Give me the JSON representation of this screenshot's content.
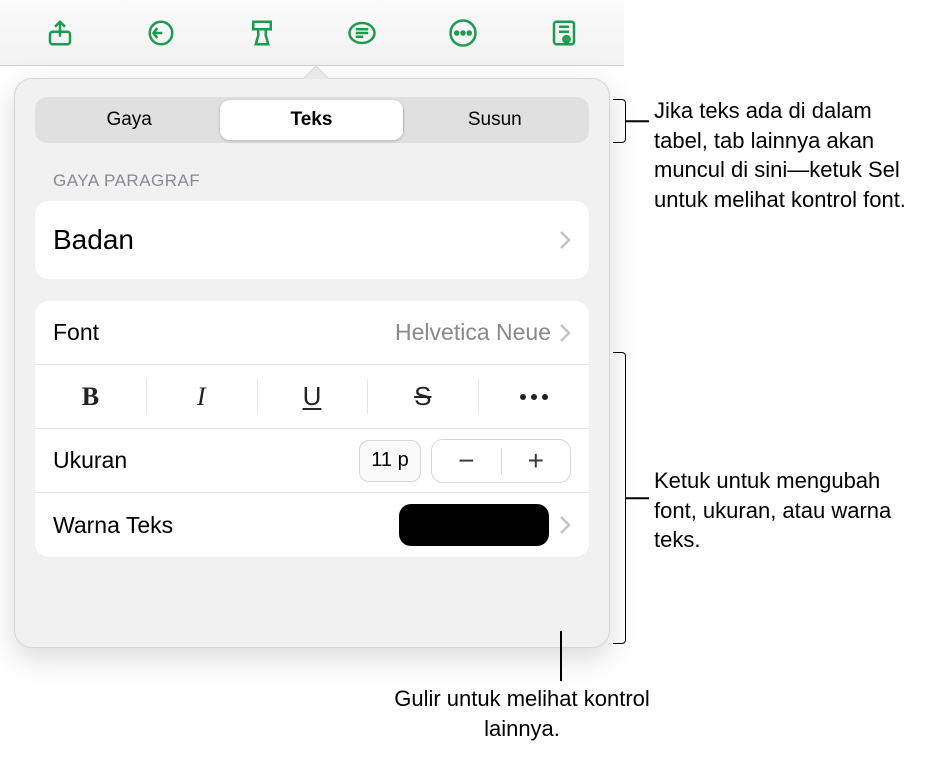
{
  "toolbar": {
    "icons": [
      "share-icon",
      "undo-icon",
      "format-brush-icon",
      "list-icon",
      "more-icon",
      "view-icon"
    ]
  },
  "segmented": {
    "items": [
      "Gaya",
      "Teks",
      "Susun"
    ],
    "active": 1
  },
  "section_label": "GAYA PARAGRAF",
  "paragraph_style": "Badan",
  "font": {
    "label": "Font",
    "value": "Helvetica Neue"
  },
  "styles": {
    "bold": "B",
    "italic": "I",
    "underline": "U",
    "strike": "S"
  },
  "size": {
    "label": "Ukuran",
    "value": "11 p"
  },
  "text_color": {
    "label": "Warna Teks",
    "value_hex": "#000000"
  },
  "annotations": {
    "tabs": "Jika teks ada di dalam tabel, tab lainnya akan muncul di sini—ketuk Sel untuk melihat kontrol font.",
    "font_controls": "Ketuk untuk mengubah font, ukuran, atau warna teks.",
    "scroll": "Gulir untuk melihat kontrol lainnya."
  }
}
